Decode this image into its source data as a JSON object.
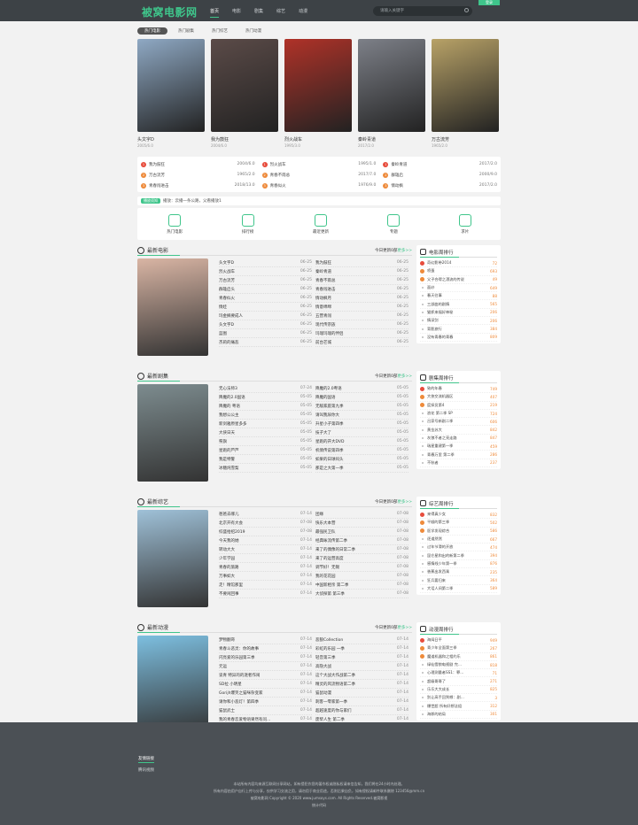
{
  "header": {
    "logo": "被窝电影网",
    "nav": [
      "首页",
      "电影",
      "剧集",
      "综艺",
      "动漫"
    ],
    "search_placeholder": "请输入关键字",
    "login": "登录"
  },
  "tabs": [
    "热门电影",
    "热门剧集",
    "热门综艺",
    "热门动漫"
  ],
  "posters": [
    {
      "title": "头文字D",
      "date": "2005/6.0",
      "color": "#8fa9c4"
    },
    {
      "title": "我为鼓狂",
      "date": "2004/6.0",
      "color": "#5b4b48"
    },
    {
      "title": "烈火战车",
      "date": "1995/3.0",
      "color": "#b03228"
    },
    {
      "title": "秦岭青道",
      "date": "2017/2.0",
      "color": "#7d8088"
    },
    {
      "title": "万古流芳",
      "date": "1965/2.0",
      "color": "#b8a267"
    }
  ],
  "ranks": [
    {
      "no": "1",
      "name": "我为鼓狂",
      "date": "2004/6.0"
    },
    {
      "no": "1",
      "name": "烈火战车",
      "date": "1995/1.0"
    },
    {
      "no": "1",
      "name": "秦岭青道",
      "date": "2017/2.0"
    },
    {
      "no": "2",
      "name": "万古流芳",
      "date": "1965/2.0"
    },
    {
      "no": "2",
      "name": "青春不雨总",
      "date": "2017/7.0"
    },
    {
      "no": "2",
      "name": "群雄启",
      "date": "2000/9.0"
    },
    {
      "no": "3",
      "name": "青春闯进击",
      "date": "2018/13.0"
    },
    {
      "no": "3",
      "name": "青春似火",
      "date": "1976/9.0"
    },
    {
      "no": "3",
      "name": "情动枫",
      "date": "2017/2.0"
    }
  ],
  "notice": {
    "badge": "播放须知",
    "text": "播放：云播一条公路，父看播放1"
  },
  "quick": [
    "热门电影",
    "排行榜",
    "最近更新",
    "专题",
    "求片"
  ],
  "sections": [
    {
      "title": "最新电影",
      "more_prefix": "今日更新0部",
      "more": "更多>>",
      "color": "#d9b5a4",
      "col1": [
        [
          "头文字D",
          "06-25"
        ],
        [
          "烈火战车",
          "06-25"
        ],
        [
          "万古流芳",
          "06-25"
        ],
        [
          "群雄启头",
          "06-25"
        ],
        [
          "青春似火",
          "06-25"
        ],
        [
          "情娃",
          "06-25"
        ],
        [
          "玛金摘要成人",
          "06-25"
        ],
        [
          "头文字D",
          "06-25"
        ],
        [
          "蓝图",
          "06-25"
        ],
        [
          "杰莉的痛悲",
          "06-25"
        ]
      ],
      "col2": [
        [
          "我为鼓狂",
          "06-25"
        ],
        [
          "秦岭青道",
          "06-25"
        ],
        [
          "青春不雨总",
          "06-25"
        ],
        [
          "青春闯进击",
          "06-25"
        ],
        [
          "情动枫月",
          "06-25"
        ],
        [
          "情意绵绵",
          "06-25"
        ],
        [
          "五营青闯",
          "06-25"
        ],
        [
          "现代传宗族",
          "06-25"
        ],
        [
          "玛瑞玛瑞的伴侣",
          "06-25"
        ],
        [
          "前台芒城",
          "06-25"
        ]
      ]
    },
    {
      "title": "最新剧集",
      "more_prefix": "今日更新0部",
      "more": "更多>>",
      "color": "#7d8c8f",
      "col1": [
        [
          "无心法师3",
          "07-24"
        ],
        [
          "降魔的2.0国语",
          "05-05"
        ],
        [
          "降魔的 粤语",
          "05-05"
        ],
        [
          "我想公公主",
          "05-05"
        ],
        [
          "新剑雅原星多多",
          "05-05"
        ],
        [
          "大侠日天",
          "05-05"
        ],
        [
          "祭旗",
          "05-05"
        ],
        [
          "星跑的芦芦",
          "05-05"
        ],
        [
          "我是特警",
          "05-05"
        ],
        [
          "冰糖炖雪梨",
          "05-05"
        ]
      ],
      "col2": [
        [
          "降魔的2.0粤语",
          "05-05"
        ],
        [
          "降魔的国语",
          "05-05"
        ],
        [
          "无敌家庭第九季",
          "05-05"
        ],
        [
          "请叫我尿你大",
          "05-05"
        ],
        [
          "升星小子第四季",
          "05-05"
        ],
        [
          "技子大了",
          "05-05"
        ],
        [
          "星跑的开大DVD",
          "05-05"
        ],
        [
          "机情传说第四季",
          "05-05"
        ],
        [
          "如果的日球闷头",
          "05-05"
        ],
        [
          "那是之大第一季",
          "05-05"
        ]
      ]
    },
    {
      "title": "最新综艺",
      "more_prefix": "今日更新0部",
      "more": "更多>>",
      "color": "#9fc1d8",
      "col1": [
        [
          "爸爸去哪儿",
          "07-14"
        ],
        [
          "北京开有大会",
          "07-08"
        ],
        [
          "综盛拾招2019",
          "07-08"
        ],
        [
          "今天我的她",
          "07-14"
        ],
        [
          "转动大大",
          "07-14"
        ],
        [
          "少年学园",
          "07-14"
        ],
        [
          "青春的旅路",
          "07-14"
        ],
        [
          "万事如大",
          "07-14"
        ],
        [
          "走！精馆那里",
          "07-14"
        ],
        [
          "不要闲回事",
          "07-14"
        ]
      ],
      "col2": [
        [
          "团缘",
          "07-08"
        ],
        [
          "快乐大本营",
          "07-08"
        ],
        [
          "最强民卫队",
          "07-08"
        ],
        [
          "经典咏流传第二季",
          "07-08"
        ],
        [
          "来了的偶像的日常二季",
          "07-08"
        ],
        [
          "来了的运营高度",
          "07-08"
        ],
        [
          "调节好！无锡",
          "07-08"
        ],
        [
          "我的花花园",
          "07-08"
        ],
        [
          "中国新相亲 第二季",
          "07-08"
        ],
        [
          "大侦探第 第三季",
          "07-08"
        ]
      ]
    },
    {
      "title": "最新动漫",
      "more_prefix": "今日更新0部",
      "more": "更多>>",
      "color": "#7dbfe0",
      "col1": [
        [
          "梦物翻哥",
          "07-14"
        ],
        [
          "青春斗恶灵：你的故事",
          "07-14"
        ],
        [
          "闪亮爱的乐园第三季",
          "07-14"
        ],
        [
          "元运",
          "07-14"
        ],
        [
          "谈青 特异的的逐者作闹",
          "07-14"
        ],
        [
          "SD拉 小明星",
          "07-14"
        ],
        [
          "Gorijh爆笑之猫咪杂变家",
          "07-14"
        ],
        [
          "请你和小恶灯！第四季",
          "07-14"
        ],
        [
          "猫鼠武士",
          "07-14"
        ],
        [
          "我的青春恋爱物语果然有问…",
          "07-14"
        ]
      ],
      "col2": [
        [
          "恶狼Collection",
          "07-14"
        ],
        [
          "彩虹的乐园 一季",
          "07-14"
        ],
        [
          "轻音第三季",
          "07-14"
        ],
        [
          "高隐大战",
          "07-14"
        ],
        [
          "这个大战大作战第二季",
          "07-14"
        ],
        [
          "精灵的风流物语第二季",
          "07-14"
        ],
        [
          "猫鼠动漫",
          "07-14"
        ],
        [
          "刺客一零家第一季",
          "07-14"
        ],
        [
          "超越速度的你与家们",
          "07-14"
        ],
        [
          "废柴人生 第二季",
          "07-14"
        ]
      ]
    }
  ],
  "sides": [
    {
      "title": "电影周排行",
      "items": [
        [
          "奇幻影带2014",
          "72"
        ],
        [
          "喷蛋",
          "693"
        ],
        [
          "父子合得之漂流的传说",
          "49"
        ],
        [
          "面纱",
          "649"
        ],
        [
          "春天往事",
          "88"
        ],
        [
          "三部曲的剧情",
          "565"
        ],
        [
          "猫抓来福好神秘",
          "206"
        ],
        [
          "情深剑",
          "206"
        ],
        [
          "背影旅行",
          "384"
        ],
        [
          "没有青春的青春",
          "809"
        ]
      ]
    },
    {
      "title": "剧集周排行",
      "items": [
        [
          "致的年春",
          "749"
        ],
        [
          "大侠交流机器区",
          "407"
        ],
        [
          "度探员第4",
          "219"
        ],
        [
          "浪花 第二季 SP",
          "724"
        ],
        [
          "吕家号新剧二季",
          "606"
        ],
        [
          "黄金苏大",
          "842"
        ],
        [
          "灰狼不者之亮走路",
          "847"
        ],
        [
          "瑞星重建第一季",
          "459"
        ],
        [
          "青春万里 第二季",
          "286"
        ],
        [
          "不秋者",
          "237"
        ]
      ]
    },
    {
      "title": "综艺周排行",
      "items": [
        [
          "来得真少女",
          "832"
        ],
        [
          "平顺的第三季",
          "502"
        ],
        [
          "医学发现综合",
          "586"
        ],
        [
          "逐道然然",
          "667"
        ],
        [
          "过年节滑的开放",
          "474"
        ],
        [
          "昆仑星和出的新第二季",
          "394"
        ],
        [
          "感情线少年第一季",
          "876"
        ],
        [
          "香蕉出发西乘",
          "235"
        ],
        [
          "狂兵要归来",
          "364"
        ],
        [
          "大话人间第二季",
          "589"
        ]
      ]
    },
    {
      "title": "动漫周排行",
      "items": [
        [
          "海阔日平",
          "949"
        ],
        [
          "青少年全面第三季",
          "267"
        ],
        [
          "魔道机器和之相约乐",
          "861"
        ],
        [
          "绿仙雪狼电视剧 完…",
          "818"
        ],
        [
          "心理测量者SS1：罪…",
          "71"
        ],
        [
          "超级哥哥了",
          "271"
        ],
        [
          "乐乐大大成长",
          "825"
        ],
        [
          "别让高手回到哪：剧…",
          "3"
        ],
        [
          "爆世超 所有好想法组",
          "312"
        ],
        [
          "海郎的结局",
          "301"
        ]
      ]
    }
  ],
  "footer": {
    "links_title": "友情链接",
    "link": "腾讯视频",
    "copy": [
      "本站所有内容均来源互联网分享网站，如有侵犯作您的著作权或隐私权请来信告知，我们将在24小时内处理。",
      "所有内容由用户自行上传与分享，仅供学习交流之用，请勿用于商业用途，否则后果自负，如有侵权请邮件联系删除 123456@mm.cn",
      "被窝电影网 Copyright © 2020 www.jumsoys.com. All Rights Reserved.被窝影视",
      "统计代码"
    ]
  }
}
